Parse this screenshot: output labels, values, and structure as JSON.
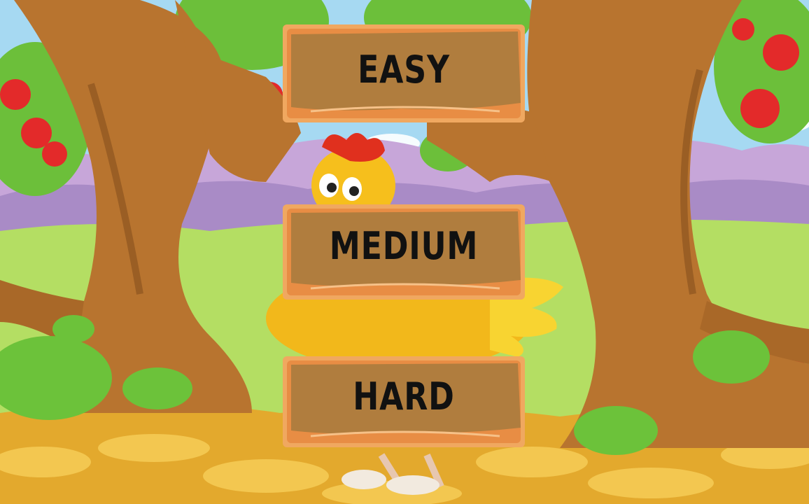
{
  "menu": {
    "easy_label": "EASY",
    "medium_label": "MEDIUM",
    "hard_label": "HARD"
  },
  "colors": {
    "sky": "#9fd6f0",
    "hills": "#c8a7d8",
    "grass": "#a8d85a",
    "trunk": "#b8742f",
    "ground": "#e8b53a",
    "sign_face": "#b07d3e",
    "sign_frame": "#f0a860",
    "chicken": "#f6bf1c",
    "comb": "#e0301e",
    "apple": "#e32a2a"
  }
}
